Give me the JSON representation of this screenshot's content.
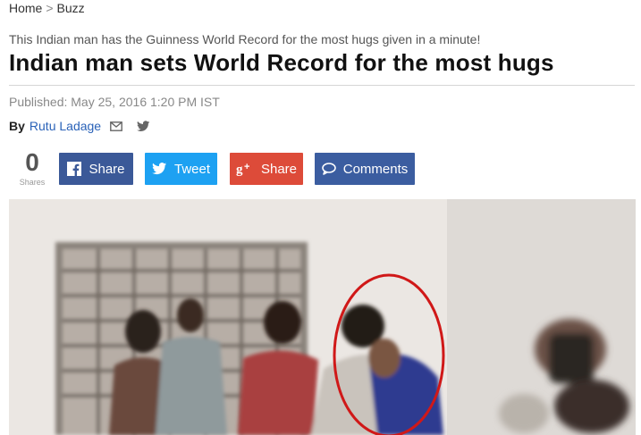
{
  "breadcrumb": {
    "home": "Home",
    "separator": ">",
    "section": "Buzz"
  },
  "article": {
    "subtitle": "This Indian man has the Guinness World Record for the most hugs given in a minute!",
    "title": "Indian man sets World Record for the most hugs",
    "published": "Published: May 25, 2016 1:20 PM IST",
    "by_label": "By",
    "author": "Rutu Ladage"
  },
  "share": {
    "count": "0",
    "count_label": "Shares",
    "facebook_label": "Share",
    "twitter_label": "Tweet",
    "google_label": "Share",
    "comments_label": "Comments"
  },
  "icons": {
    "byline": [
      "mail-icon",
      "twitter-icon"
    ],
    "buttons": [
      "facebook-icon",
      "twitter-icon",
      "google-plus-icon",
      "comment-icon"
    ]
  },
  "colors": {
    "facebook": "#3b5998",
    "twitter": "#1da1f2",
    "google": "#dd4b39",
    "comments": "#3b5da0",
    "link": "#2a62b8",
    "annotation_circle": "#d01818"
  }
}
